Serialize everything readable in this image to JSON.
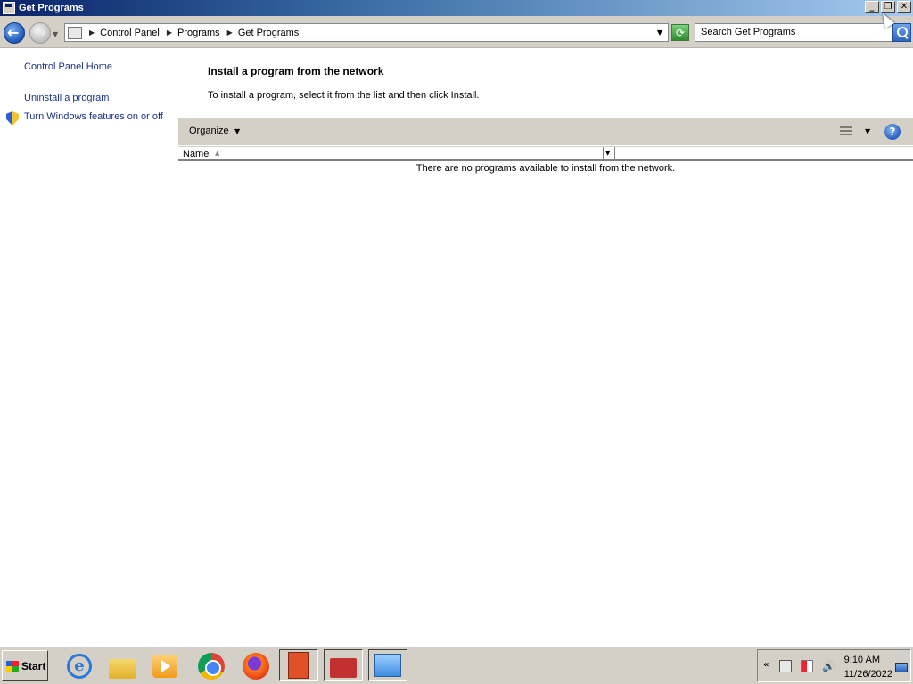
{
  "window": {
    "title": "Get Programs",
    "buttons": {
      "minimize": "_",
      "restore": "❐",
      "close": "✕"
    }
  },
  "address_bar": {
    "breadcrumbs": [
      "Control Panel",
      "Programs",
      "Get Programs"
    ],
    "search_placeholder": "Search Get Programs"
  },
  "left_pane": {
    "links": [
      "Control Panel Home",
      "Uninstall a program",
      "Turn Windows features on or off"
    ]
  },
  "main": {
    "heading": "Install a program from the network",
    "instructions": "To install a program, select it from the list and then click Install.",
    "toolbar": {
      "organize_label": "Organize",
      "help_label": "?"
    },
    "columns": [
      "Name"
    ],
    "empty_message": "There are no programs available to install from the network."
  },
  "taskbar": {
    "start_label": "Start",
    "pinned": [
      "internet-explorer",
      "windows-explorer",
      "media-player",
      "chrome",
      "firefox",
      "app-red",
      "toolbox",
      "control-panel"
    ],
    "tray_chevron": "«",
    "speaker_glyph": "🔊",
    "clock": {
      "time": "9:10 AM",
      "date": "11/26/2022"
    }
  },
  "colors": {
    "title_bar": "#0a246a",
    "link": "#1e3287",
    "chrome_bg": "#d4d0c8"
  }
}
